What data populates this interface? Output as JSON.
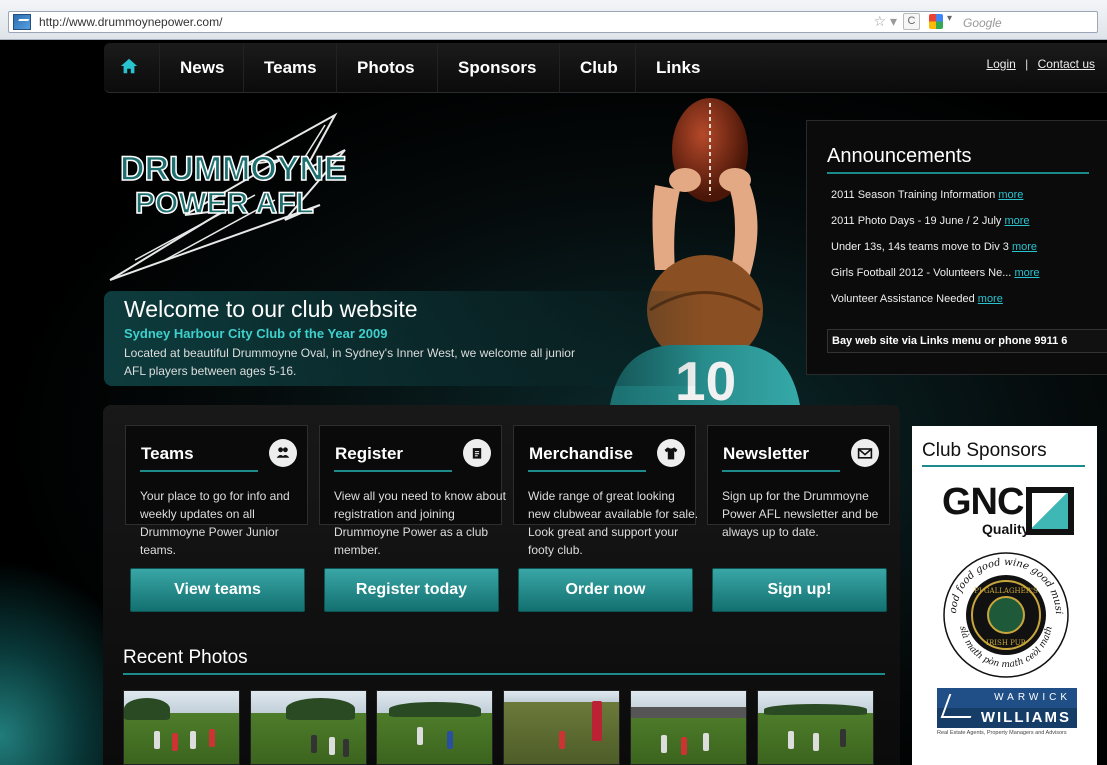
{
  "browser": {
    "url": "http://www.drummoynepower.com/",
    "search_placeholder": "Google"
  },
  "nav": {
    "items": [
      "News",
      "Teams",
      "Photos",
      "Sponsors",
      "Club",
      "Links"
    ],
    "login": "Login",
    "separator": "|",
    "contact": "Contact us"
  },
  "hero": {
    "logo_line1": "DRUMMOYNE",
    "logo_line2": "POWER AFL",
    "title": "Welcome to our club website",
    "subtitle": "Sydney Harbour City Club of the Year 2009",
    "text": "Located at beautiful Drummoyne Oval, in Sydney's Inner West, we welcome all junior AFL players between ages 5-16.",
    "jersey_number": "10"
  },
  "announcements": {
    "title": "Announcements",
    "items": [
      {
        "text": "2011 Season Training Information",
        "link": "more"
      },
      {
        "text": "2011 Photo Days - 19 June / 2 July",
        "link": "more"
      },
      {
        "text": "Under 13s, 14s teams move to Div 3",
        "link": "more"
      },
      {
        "text": "Girls Football 2012 - Volunteers Ne...",
        "link": "more"
      },
      {
        "text": "Volunteer Assistance Needed",
        "link": "more"
      }
    ],
    "ticker": "Bay web site via Links menu or phone 9911 6"
  },
  "cards": [
    {
      "title": "Teams",
      "icon": "people-icon",
      "desc": "Your place to go for info and weekly updates on all Drummoyne Power Junior teams.",
      "cta": "View teams"
    },
    {
      "title": "Register",
      "icon": "clipboard-icon",
      "desc": "View all you need to know about registration and joining Drummoyne Power as a club member.",
      "cta": "Register today"
    },
    {
      "title": "Merchandise",
      "icon": "shirt-icon",
      "desc": "Wide range of great looking new clubwear available for sale. Look great and support your footy club.",
      "cta": "Order now"
    },
    {
      "title": "Newsletter",
      "icon": "envelope-icon",
      "desc": "Sign up for the Drummoyne Power AFL newsletter and be always up to date.",
      "cta": "Sign up!"
    }
  ],
  "recent": {
    "title": "Recent Photos",
    "count": 6
  },
  "sponsors": {
    "title": "Club Sponsors",
    "gnc": "GNC",
    "gnc_sub": "Quality",
    "pub_ring": "good food good wine good music",
    "pub_ring_bottom": "slà math pòn math ceòl math",
    "pub_name": "PJ GALLAGHER'S",
    "pub_sub": "IRISH PUB",
    "ww_top": "WARWICK",
    "ww_bottom": "WILLIAMS",
    "ww_tag": "Real Estate Agents, Property Managers and Advisors"
  },
  "colors": {
    "accent": "#1d8a8c",
    "link": "#29c3d0",
    "teal_sub": "#3fd0cd"
  }
}
